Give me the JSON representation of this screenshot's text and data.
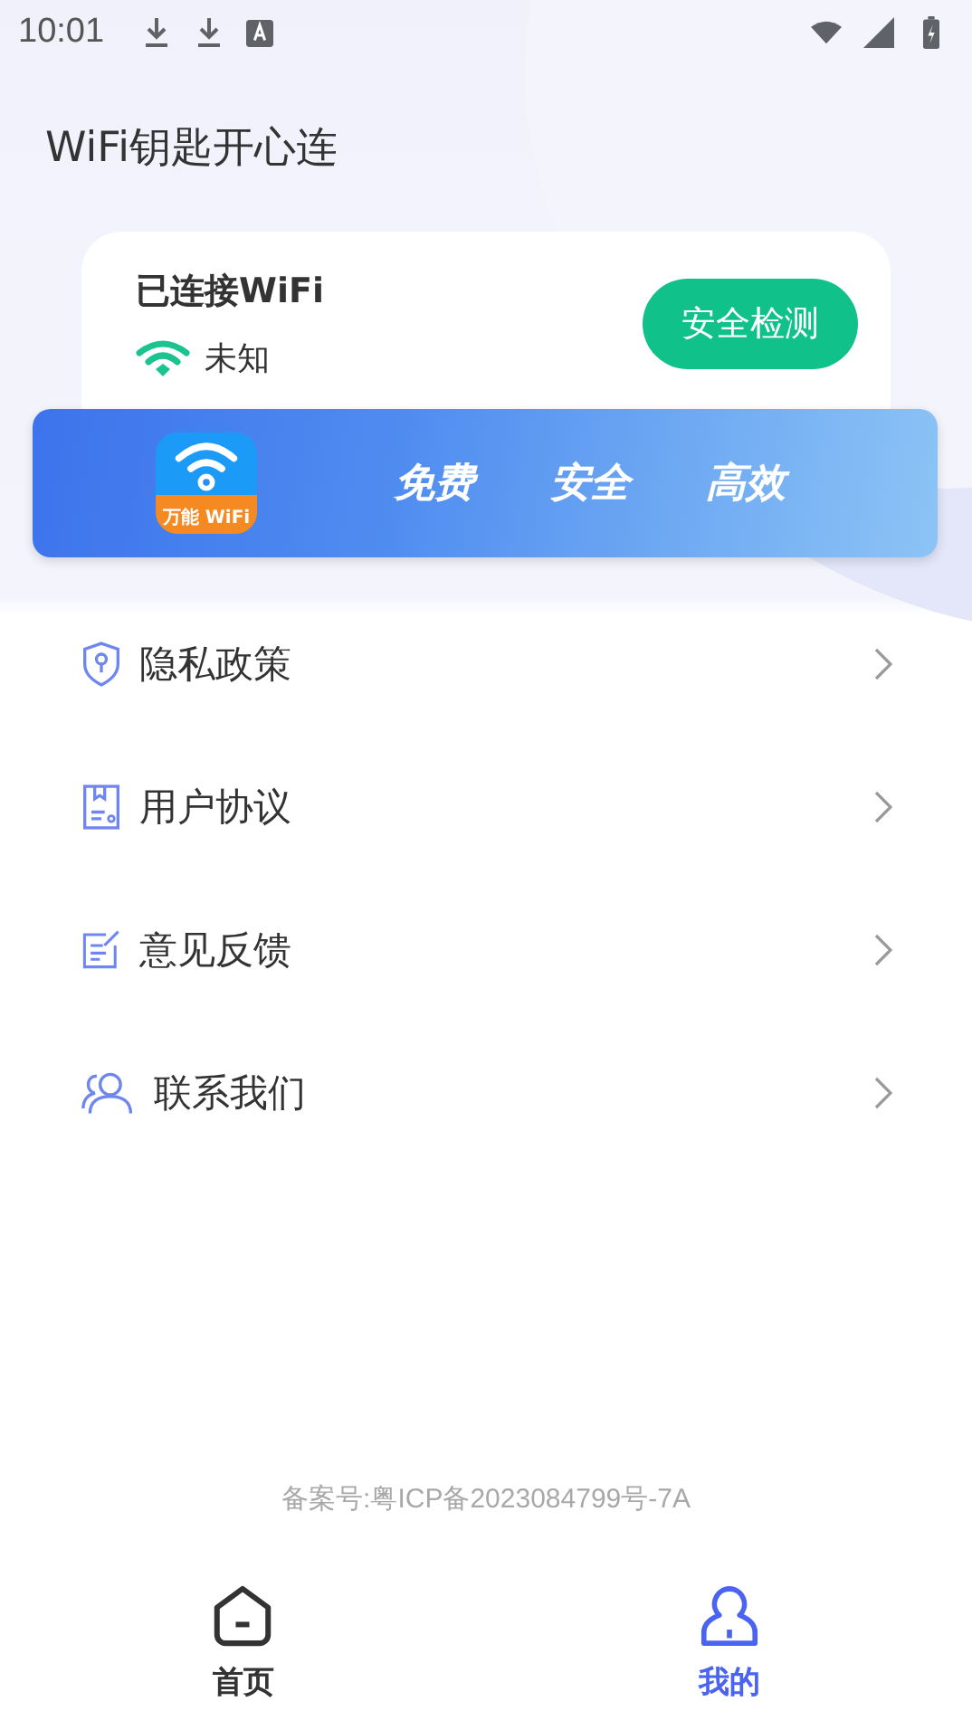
{
  "status_bar": {
    "time": "10:01"
  },
  "title": "WiFi钥匙开心连",
  "connection": {
    "heading": "已连接WiFi",
    "network": "未知",
    "button": "安全检测"
  },
  "banner": {
    "logo_text": "万能 WiFi",
    "slogans": [
      "免费",
      "安全",
      "高效"
    ]
  },
  "menu": [
    {
      "kind": "shield",
      "label": "隐私政策"
    },
    {
      "kind": "document",
      "label": "用户协议"
    },
    {
      "kind": "edit",
      "label": "意见反馈"
    },
    {
      "kind": "people",
      "label": "联系我们"
    }
  ],
  "footer": "备案号:粤ICP备2023084799号-7A",
  "tabs": [
    {
      "kind": "home",
      "label": "首页",
      "selected": false
    },
    {
      "kind": "user",
      "label": "我的",
      "selected": true
    }
  ]
}
